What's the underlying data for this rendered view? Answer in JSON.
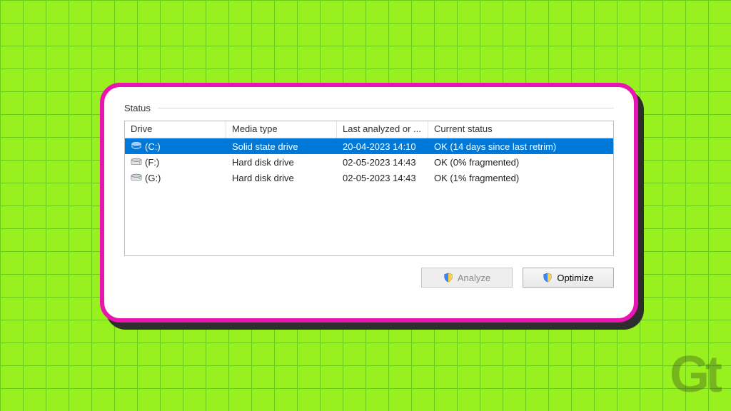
{
  "section_label": "Status",
  "columns": {
    "drive": "Drive",
    "media": "Media type",
    "last": "Last analyzed or ...",
    "status": "Current status"
  },
  "rows": [
    {
      "drive": "(C:)",
      "media": "Solid state drive",
      "last": "20-04-2023 14:10",
      "status": "OK (14 days since last retrim)",
      "icon": "ssd",
      "selected": true
    },
    {
      "drive": "(F:)",
      "media": "Hard disk drive",
      "last": "02-05-2023 14:43",
      "status": "OK (0% fragmented)",
      "icon": "hdd",
      "selected": false
    },
    {
      "drive": "(G:)",
      "media": "Hard disk drive",
      "last": "02-05-2023 14:43",
      "status": "OK (1% fragmented)",
      "icon": "hdd",
      "selected": false
    }
  ],
  "buttons": {
    "analyze": "Analyze",
    "optimize": "Optimize"
  },
  "watermark": "Gt"
}
